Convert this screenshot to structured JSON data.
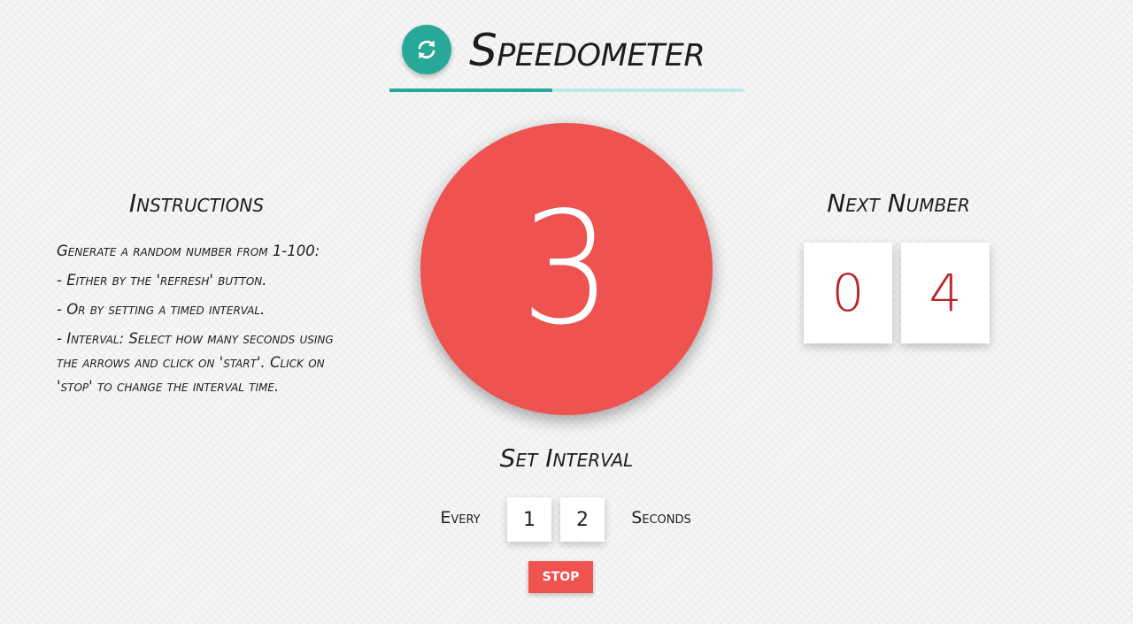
{
  "header": {
    "title": "Speedometer",
    "refresh_icon": "refresh-icon",
    "accent_color": "#27a899",
    "progress_fraction": 0.46
  },
  "instructions": {
    "title": "Instructions",
    "lines": [
      "Generate a random number from 1-100:",
      "- Either by the 'refresh' button.",
      "- Or by setting a timed interval.",
      "- Interval: Select how many seconds using the arrows and click on 'start'. Click on 'stop' to change the interval time."
    ]
  },
  "current_number": {
    "value": "3",
    "circle_color": "#ef5350"
  },
  "next_number": {
    "title": "Next Number",
    "digits": [
      "0",
      "4"
    ],
    "digit_color": "#b7262c"
  },
  "interval": {
    "title": "Set Interval",
    "every_label": "Every",
    "digits": [
      "1",
      "2"
    ],
    "seconds_label": "Seconds",
    "stop_label": "STOP"
  }
}
